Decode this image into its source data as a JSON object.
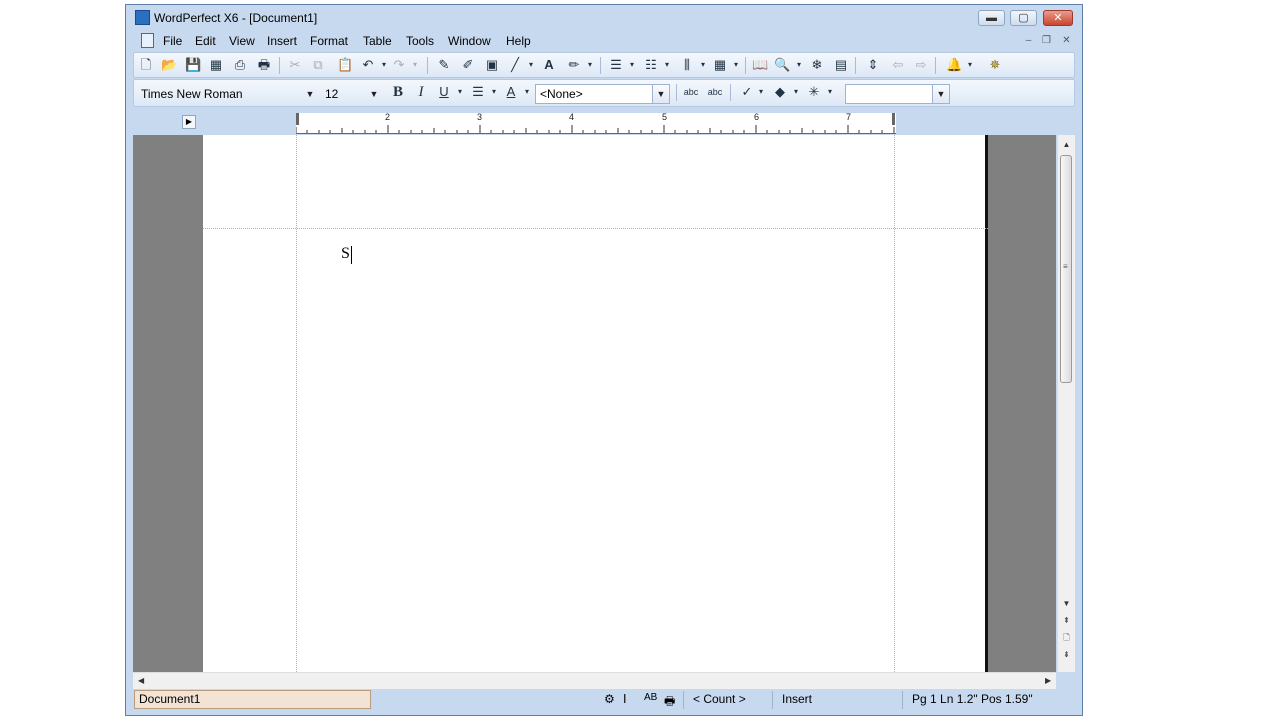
{
  "window": {
    "title": "WordPerfect X6 - [Document1]",
    "caption_buttons": {
      "minimize": "▬",
      "maximize": "▢",
      "close": "✕"
    }
  },
  "menubar": {
    "items": [
      "File",
      "Edit",
      "View",
      "Insert",
      "Format",
      "Table",
      "Tools",
      "Window",
      "Help"
    ],
    "mdi_buttons": {
      "minimize": "–",
      "restore": "❐",
      "close": "✕"
    }
  },
  "toolbar2": {
    "font_name": "Times New Roman",
    "font_size": "12",
    "style": "<None>",
    "bold": "B",
    "italic": "I",
    "underline": "U"
  },
  "ruler": {
    "labels": [
      "2",
      "3",
      "4",
      "5",
      "6",
      "7"
    ]
  },
  "document": {
    "text": "S"
  },
  "statusbar": {
    "document_name": "Document1",
    "count": "< Count >",
    "mode": "Insert",
    "position": "Pg 1 Ln 1.2\" Pos 1.59\""
  },
  "colors": {
    "chrome": "#c7d9ef",
    "doc_background": "#808080",
    "page": "#ffffff",
    "status_doc_tab": "#f3e3d5"
  }
}
